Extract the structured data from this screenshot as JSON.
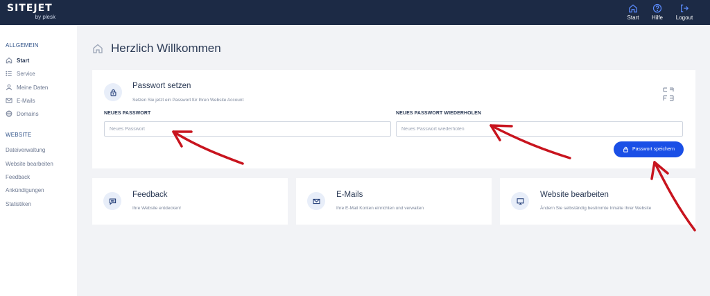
{
  "brand": {
    "name": "SITEJET",
    "sub": "by plesk"
  },
  "top_nav": [
    {
      "label": "Start",
      "icon": "home-icon"
    },
    {
      "label": "Hilfe",
      "icon": "help-icon"
    },
    {
      "label": "Logout",
      "icon": "logout-icon"
    }
  ],
  "sidebar": {
    "section1": "ALLGEMEIN",
    "items": [
      {
        "label": "Start",
        "icon": "home-icon",
        "active": true
      },
      {
        "label": "Service",
        "icon": "list-icon"
      },
      {
        "label": "Meine Daten",
        "icon": "user-icon"
      },
      {
        "label": "E-Mails",
        "icon": "mail-icon"
      },
      {
        "label": "Domains",
        "icon": "globe-icon"
      }
    ],
    "section2": "WEBSITE",
    "links": [
      "Dateiverwaltung",
      "Website bearbeiten",
      "Feedback",
      "Ankündigungen",
      "Statistiken"
    ]
  },
  "page": {
    "title": "Herzlich Willkommen"
  },
  "password_card": {
    "title": "Passwort setzen",
    "subtitle": "Setzen Sie jetzt ein Passwort für Ihren Website Account",
    "new_label": "NEUES PASSWORT",
    "new_placeholder": "Neues Passwort",
    "repeat_label": "NEUES PASSWORT WIEDERHOLEN",
    "repeat_placeholder": "Neues Passwort wiederholen",
    "save_label": "Passwort speichern"
  },
  "cards": [
    {
      "title": "Feedback",
      "subtitle": "Ihre Website entdecken!",
      "icon": "chat-icon"
    },
    {
      "title": "E-Mails",
      "subtitle": "Ihre E-Mail Konten einrichten und verwalten",
      "icon": "mail-icon"
    },
    {
      "title": "Website bearbeiten",
      "subtitle": "Ändern Sie selbständig bestimmte Inhalte Ihrer Website",
      "icon": "monitor-icon"
    }
  ],
  "colors": {
    "topbar": "#1c2a45",
    "accent": "#1a4fe6",
    "annotation_arrow": "#c8141e",
    "background": "#f2f3f6"
  }
}
